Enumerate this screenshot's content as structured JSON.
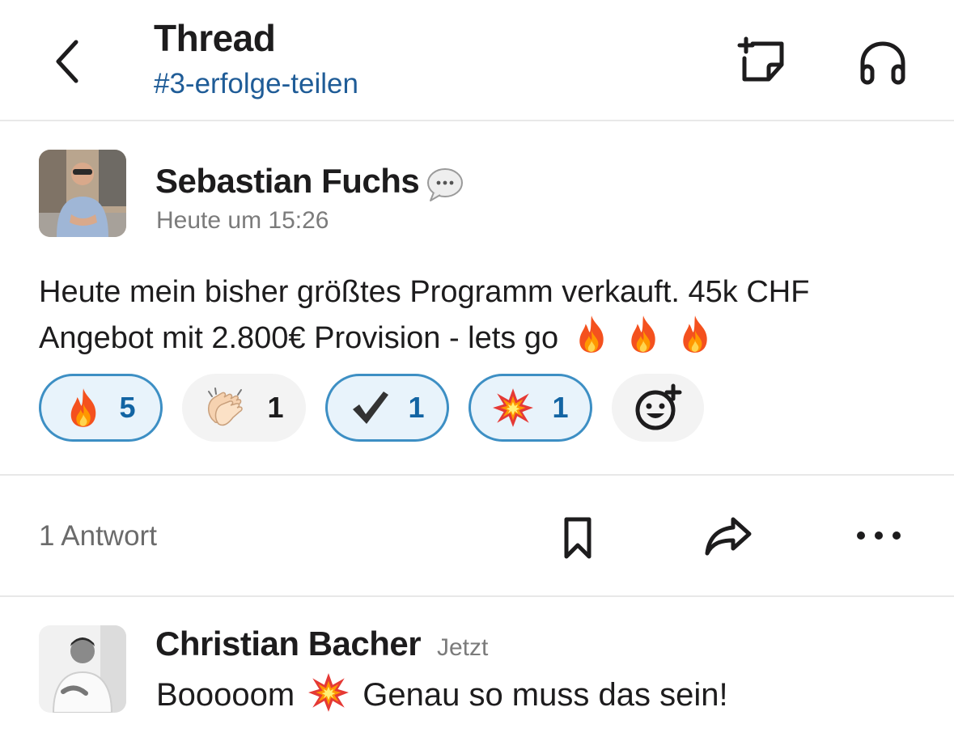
{
  "header": {
    "title": "Thread",
    "channel": "#3-erfolge-teilen",
    "back_icon": "chevron-left-icon",
    "new_note_icon": "new-note-icon",
    "huddle_icon": "headphones-icon"
  },
  "message": {
    "author": "Sebastian Fuchs",
    "status_icon": "speech-bubble-icon",
    "timestamp": "Heute um 15:26",
    "text": "Heute mein bisher größtes Programm verkauft. 45k CHF Angebot mit 2.800€ Provision -  lets go",
    "trailing_emojis": [
      "fire",
      "fire",
      "fire"
    ],
    "reactions": [
      {
        "emoji": "fire",
        "count": "5",
        "active": true
      },
      {
        "emoji": "clapping-hands",
        "count": "1",
        "active": false
      },
      {
        "emoji": "heavy-check-mark",
        "count": "1",
        "active": true
      },
      {
        "emoji": "collision",
        "count": "1",
        "active": true
      }
    ],
    "add_reaction_icon": "add-reaction-icon"
  },
  "actions": {
    "reply_count": "1 Antwort",
    "save_icon": "bookmark-icon",
    "share_icon": "share-arrow-icon",
    "more_icon": "more-horizontal-icon"
  },
  "reply": {
    "author": "Christian Bacher",
    "time": "Jetzt",
    "text_before": "Booooom",
    "emoji": "collision",
    "text_after": "Genau so muss das sein!"
  },
  "colors": {
    "channel_link": "#1f5c97",
    "reaction_active_border": "#3d8fc4",
    "reaction_active_bg": "#e8f3fb",
    "reaction_count_active": "#1264a3"
  }
}
